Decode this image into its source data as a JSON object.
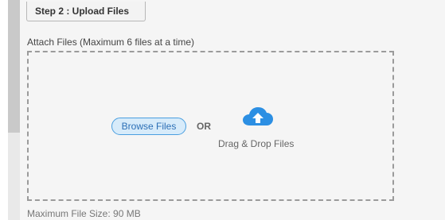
{
  "step": {
    "title": "Step 2 : Upload Files"
  },
  "attach": {
    "label": "Attach Files (Maximum 6 files at a time)"
  },
  "dropzone": {
    "browse_label": "Browse Files",
    "or_label": "OR",
    "drag_drop_label": "Drag & Drop Files",
    "icon": "cloud-upload-icon"
  },
  "footer": {
    "max_size": "Maximum File Size: 90 MB"
  },
  "colors": {
    "accent": "#2c8fe3",
    "browse_fill": "#d7ebfa",
    "dashed_border": "#9b9b9b"
  }
}
